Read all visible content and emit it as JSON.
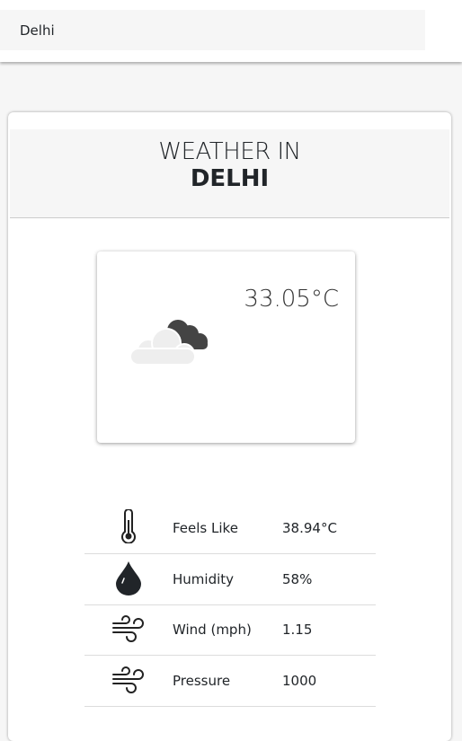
{
  "search": {
    "value": "Delhi"
  },
  "header": {
    "line1": "WEATHER IN",
    "city": "DELHI"
  },
  "current": {
    "temperature": "33.05°C",
    "icon": "cloudy-icon"
  },
  "details": [
    {
      "icon": "thermometer-icon",
      "label": "Feels Like",
      "value": "38.94°C"
    },
    {
      "icon": "droplet-icon",
      "label": "Humidity",
      "value": "58%"
    },
    {
      "icon": "wind-icon",
      "label": "Wind (mph)",
      "value": "1.15"
    },
    {
      "icon": "wind-icon",
      "label": "Pressure",
      "value": "1000"
    }
  ]
}
